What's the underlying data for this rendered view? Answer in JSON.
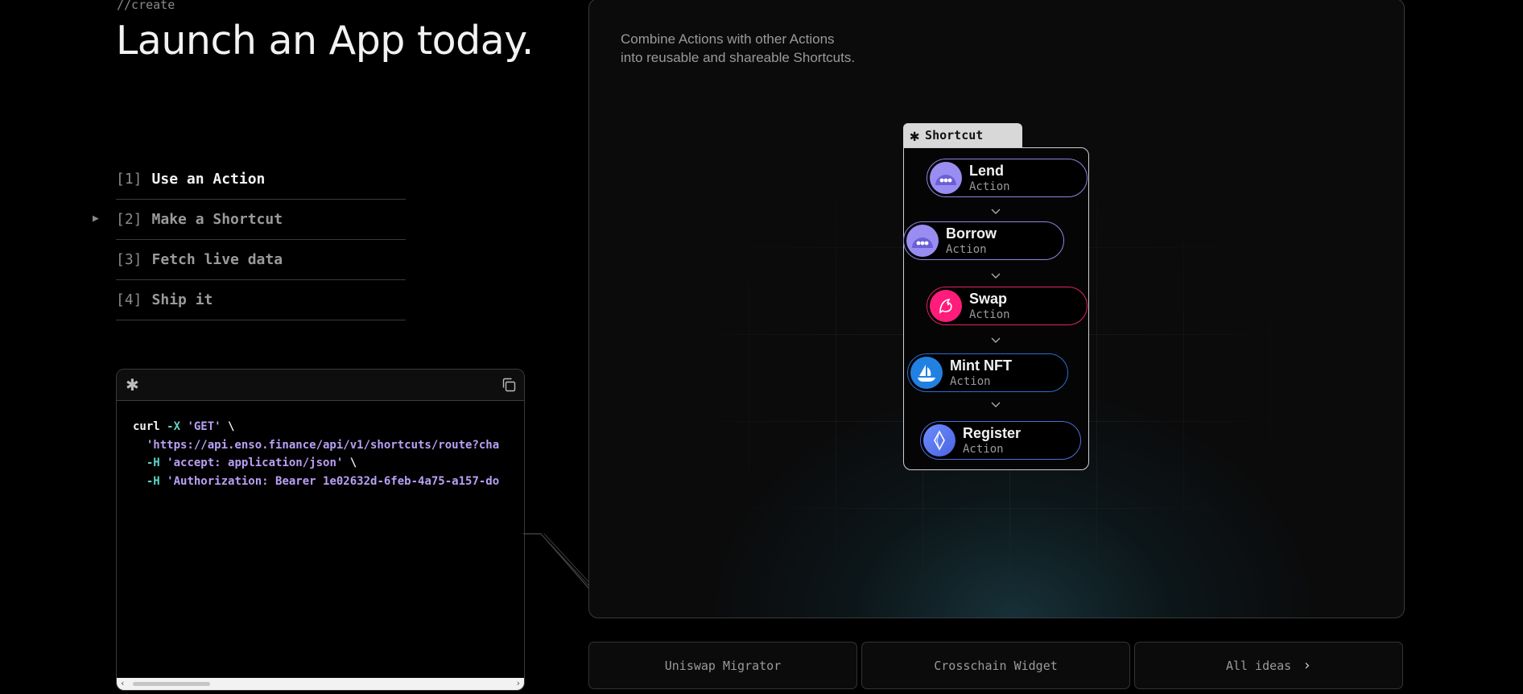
{
  "hero": {
    "eyebrow": "//create",
    "title": "Launch an App today."
  },
  "steps": [
    {
      "num": "[1]",
      "label": "Use an Action",
      "active": true
    },
    {
      "num": "[2]",
      "label": "Make a Shortcut",
      "active": false
    },
    {
      "num": "[3]",
      "label": "Fetch live data",
      "active": false
    },
    {
      "num": "[4]",
      "label": "Ship it",
      "active": false
    }
  ],
  "code": {
    "lines": [
      {
        "cmd": "curl",
        "flag": "-X",
        "str": "'GET'",
        "tail": "\\"
      },
      {
        "str": "'https://api.enso.finance/api/v1/shortcuts/route?cha"
      },
      {
        "flag": "-H",
        "str": "'accept: application/json'",
        "tail": "\\"
      },
      {
        "flag": "-H",
        "str": "'Authorization: Bearer 1e02632d-6feb-4a75-a157-do"
      }
    ]
  },
  "panel": {
    "description_line1": "Combine Actions with other Actions",
    "description_line2": "into reusable and shareable Shortcuts."
  },
  "shortcut": {
    "title": "Shortcut",
    "nodes": [
      {
        "name": "Lend",
        "sub": "Action",
        "border": "#8f86e0",
        "logo": "#9a8df2",
        "icon": "morpho-icon"
      },
      {
        "name": "Borrow",
        "sub": "Action",
        "border": "#8f86e0",
        "logo": "#9a8df2",
        "icon": "morpho-icon"
      },
      {
        "name": "Swap",
        "sub": "Action",
        "border": "#e0245e",
        "logo": "#ff1c7a",
        "icon": "uniswap-unicorn-icon"
      },
      {
        "name": "Mint NFT",
        "sub": "Action",
        "border": "#2a6ecf",
        "logo": "#2081e2",
        "icon": "opensea-boat-icon"
      },
      {
        "name": "Register",
        "sub": "Action",
        "border": "#4f6ed8",
        "logo": "#5c7cfa",
        "icon": "ens-icon"
      }
    ]
  },
  "bottom": {
    "btn1": "Uniswap Migrator",
    "btn2": "Crosschain Widget",
    "btn3": "All ideas"
  }
}
